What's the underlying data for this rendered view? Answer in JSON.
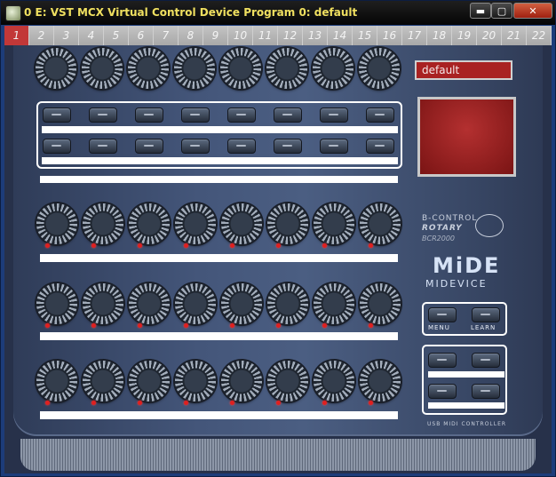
{
  "window": {
    "title": "0 E: VST MCX Virtual Control Device Program 0: default",
    "minimize_glyph": "▬",
    "maximize_glyph": "▢",
    "close_glyph": "✕",
    "icon": "app-icon"
  },
  "tabs": {
    "active_index": 0,
    "labels": [
      "1",
      "2",
      "3",
      "4",
      "5",
      "6",
      "7",
      "8",
      "9",
      "10",
      "11",
      "12",
      "13",
      "14",
      "15",
      "16",
      "17",
      "18",
      "19",
      "20",
      "21",
      "22"
    ]
  },
  "device": {
    "preset_name": "default",
    "brand_line1": "B-CONTROL",
    "brand_line2": "ROTARY",
    "model": "BCR2000",
    "logo_main": "MiDE",
    "logo_sub": "MIDEVICE",
    "menu_label": "MENU",
    "learn_label": "LEARN",
    "footer_label": "USB MIDI CONTROLLER",
    "colors": {
      "panel": "#44567a",
      "display": "#a92222",
      "led": "#e02020",
      "active_tab": "#c23838"
    }
  }
}
